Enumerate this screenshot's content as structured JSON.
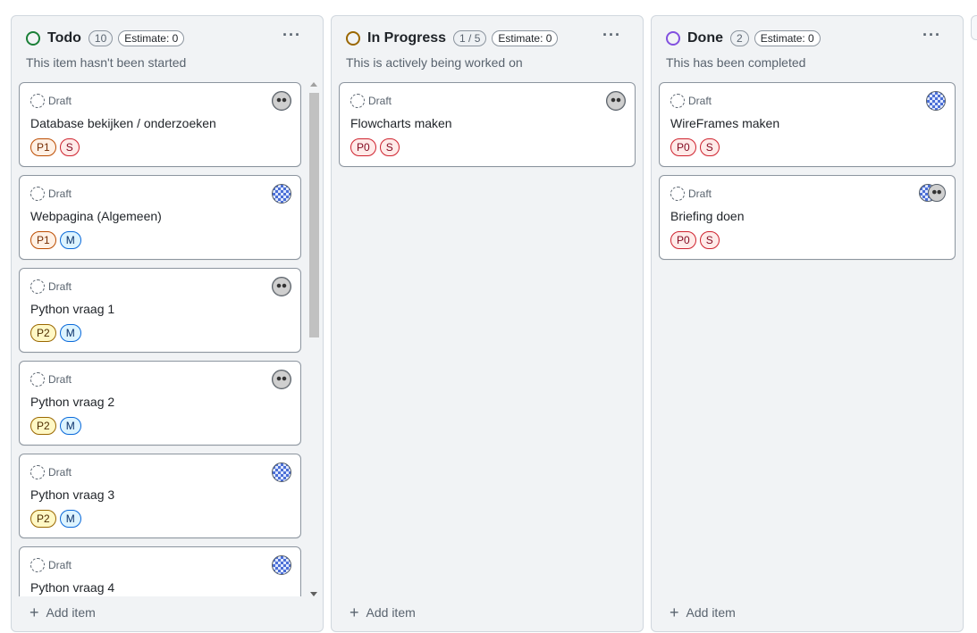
{
  "columns": {
    "todo": {
      "title": "Todo",
      "count": "10",
      "estimate": "Estimate: 0",
      "description": "This item hasn't been started",
      "status_color": "#1a7f37",
      "cards": [
        {
          "state": "Draft",
          "title": "Database bekijken / onderzoeken",
          "labels": [
            "P1",
            "S"
          ],
          "avatar": "face"
        },
        {
          "state": "Draft",
          "title": "Webpagina (Algemeen)",
          "labels": [
            "P1",
            "M"
          ],
          "avatar": "check"
        },
        {
          "state": "Draft",
          "title": "Python vraag 1",
          "labels": [
            "P2",
            "M"
          ],
          "avatar": "face"
        },
        {
          "state": "Draft",
          "title": "Python vraag 2",
          "labels": [
            "P2",
            "M"
          ],
          "avatar": "face"
        },
        {
          "state": "Draft",
          "title": "Python vraag 3",
          "labels": [
            "P2",
            "M"
          ],
          "avatar": "check"
        },
        {
          "state": "Draft",
          "title": "Python vraag 4",
          "labels": [],
          "avatar": "check"
        }
      ],
      "add_item": "Add item"
    },
    "progress": {
      "title": "In Progress",
      "count": "1 / 5",
      "estimate": "Estimate: 0",
      "description": "This is actively being worked on",
      "status_color": "#9a6700",
      "cards": [
        {
          "state": "Draft",
          "title": "Flowcharts maken",
          "labels": [
            "P0",
            "S"
          ],
          "avatar": "face"
        }
      ],
      "add_item": "Add item"
    },
    "done": {
      "title": "Done",
      "count": "2",
      "estimate": "Estimate: 0",
      "description": "This has been completed",
      "status_color": "#8250df",
      "cards": [
        {
          "state": "Draft",
          "title": "WireFrames maken",
          "labels": [
            "P0",
            "S"
          ],
          "avatar": "check"
        },
        {
          "state": "Draft",
          "title": "Briefing doen",
          "labels": [
            "P0",
            "S"
          ],
          "avatar": "pair"
        }
      ],
      "add_item": "Add item"
    }
  },
  "icons": {
    "more": "kebab-horizontal-icon",
    "draft": "draft-circle-icon",
    "add": "plus-icon"
  }
}
